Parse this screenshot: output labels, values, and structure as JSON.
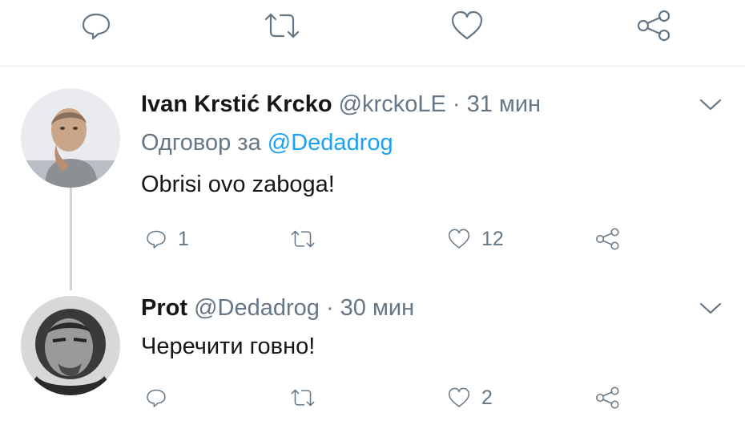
{
  "top_actions": {
    "reply_icon": "speech-bubble",
    "retweet_icon": "retweet-arrows",
    "like_icon": "heart",
    "share_icon": "share-nodes"
  },
  "tweets": [
    {
      "name": "Ivan Krstić Krcko",
      "handle": "@krckoLE",
      "separator": "·",
      "time": "31 мин",
      "reply_prefix": "Одговор за",
      "reply_mention": "@Dedadrog",
      "text": "Obrisi ovo zaboga!",
      "reply_count": "1",
      "retweet_count": "",
      "like_count": "12"
    },
    {
      "name": "Prot",
      "handle": "@Dedadrog",
      "separator": "·",
      "time": "30 мин",
      "text": "Черечити говно!",
      "reply_count": "",
      "retweet_count": "",
      "like_count": "2"
    }
  ],
  "colors": {
    "icon_gray": "#657786",
    "link_blue": "#1da1f2",
    "text_dark": "#14171a",
    "divider": "#e6ecf0"
  }
}
